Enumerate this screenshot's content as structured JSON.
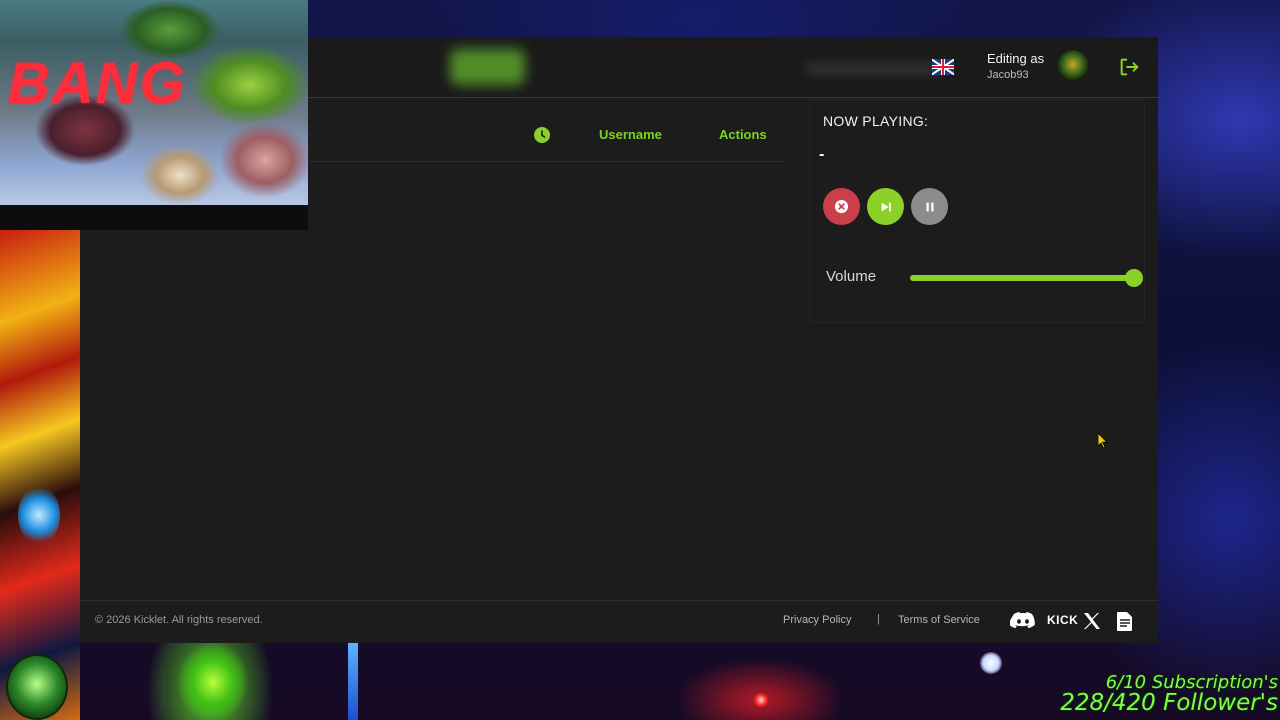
{
  "overlay": {
    "webcam_text": "BANG",
    "subscriptions": "6/10 Subscription's",
    "followers": "228/420 Follower's"
  },
  "header": {
    "language_flag": "uk-flag-icon",
    "editing_label": "Editing as",
    "username": "Jacob93"
  },
  "queue_table": {
    "columns": [
      "",
      "Username",
      "Actions"
    ],
    "rows": []
  },
  "player": {
    "title": "NOW PLAYING:",
    "track": "-",
    "volume_label": "Volume",
    "volume_level": 1.0,
    "controls": [
      "close-icon",
      "skip-next-icon",
      "pause-icon"
    ]
  },
  "footer": {
    "copyright": "© 2026 Kicklet. All rights reserved.",
    "privacy": "Privacy Policy",
    "separator": "|",
    "terms": "Terms of Service",
    "kick": "KICK",
    "social_icons": [
      "discord-icon",
      "kick-icon",
      "x-icon",
      "document-icon"
    ]
  },
  "colors": {
    "accent": "#8bd12a",
    "danger": "#c9404a",
    "panel": "#1c1c1c"
  }
}
